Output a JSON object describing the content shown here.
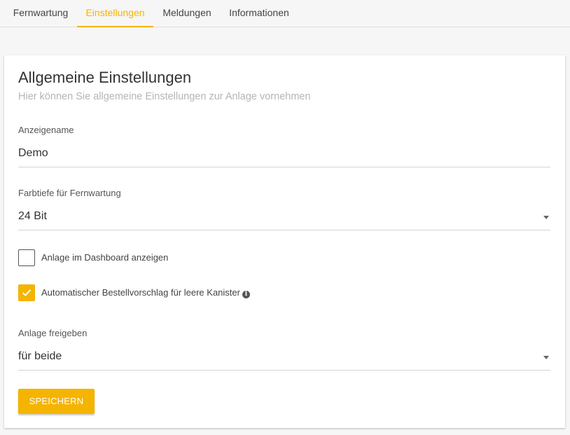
{
  "tabs": [
    {
      "label": "Fernwartung",
      "active": false
    },
    {
      "label": "Einstellungen",
      "active": true
    },
    {
      "label": "Meldungen",
      "active": false
    },
    {
      "label": "Informationen",
      "active": false
    }
  ],
  "colors": {
    "accent": "#f5b400",
    "subtitle": "#b5b5b5"
  },
  "card": {
    "title": "Allgemeine Einstellungen",
    "subtitle": "Hier können Sie allgemeine Einstellungen zur Anlage vornehmen"
  },
  "form": {
    "display_name": {
      "label": "Anzeigename",
      "value": "Demo"
    },
    "color_depth": {
      "label": "Farbtiefe für Fernwartung",
      "value": "24 Bit"
    },
    "show_in_dashboard": {
      "label": "Anlage im Dashboard anzeigen",
      "checked": false
    },
    "auto_order": {
      "label": "Automatischer Bestellvorschlag für leere Kanister",
      "checked": true,
      "info_icon": "info-circle-icon"
    },
    "share": {
      "label": "Anlage freigeben",
      "value": "für beide"
    },
    "save_label": "SPEICHERN"
  }
}
